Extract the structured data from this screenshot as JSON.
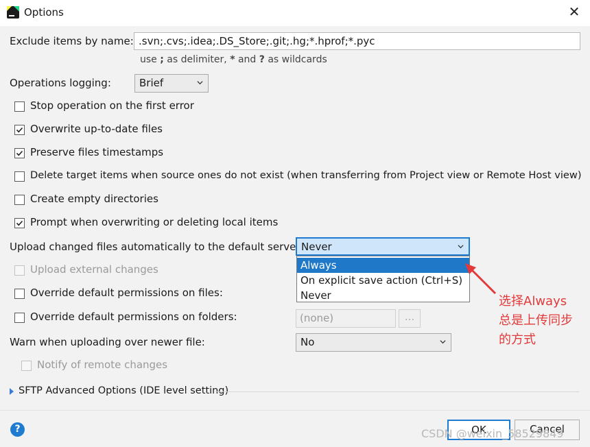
{
  "window": {
    "title": "Options"
  },
  "exclude": {
    "label": "Exclude items by name:",
    "value": ".svn;.cvs;.idea;.DS_Store;.git;.hg;*.hprof;*.pyc",
    "hint_prefix": "use ",
    "hint_semicolon": ";",
    "hint_mid": " as delimiter, ",
    "hint_star": "*",
    "hint_and": " and ",
    "hint_q": "?",
    "hint_suffix": " as wildcards"
  },
  "operations_logging": {
    "label": "Operations logging:",
    "value": "Brief"
  },
  "checkboxes": [
    {
      "label": "Stop operation on the first error",
      "checked": false
    },
    {
      "label": "Overwrite up-to-date files",
      "checked": true
    },
    {
      "label": "Preserve files timestamps",
      "checked": true
    },
    {
      "label": "Delete target items when source ones do not exist (when transferring from Project view or Remote Host view)",
      "checked": false
    },
    {
      "label": "Create empty directories",
      "checked": false
    },
    {
      "label": "Prompt when overwriting or deleting local items",
      "checked": true
    }
  ],
  "upload_changed": {
    "label": "Upload changed files automatically to the default server",
    "value": "Never",
    "options": [
      "Always",
      "On explicit save action (Ctrl+S)",
      "Never"
    ],
    "highlighted": "Always"
  },
  "upload_external": {
    "label": "Upload external changes"
  },
  "override_files": {
    "label": "Override default permissions on files:"
  },
  "override_folders": {
    "label": "Override default permissions on folders:",
    "value": "(none)",
    "button": "..."
  },
  "warn_newer": {
    "label": "Warn when uploading over newer file:",
    "value": "No"
  },
  "notify_remote": {
    "label": "Notify of remote changes"
  },
  "sftp_section": {
    "label": "SFTP Advanced Options (IDE level setting)"
  },
  "buttons": {
    "ok": "OK",
    "cancel": "Cancel",
    "help": "?"
  },
  "annotation": {
    "lines": [
      "选择Always",
      "总是上传同步",
      "的方式"
    ],
    "color": "#e23a3a"
  },
  "watermark": "CSDN @weixin_58529849",
  "colors": {
    "accent": "#1f7bcf",
    "selection": "#1f78c8"
  }
}
